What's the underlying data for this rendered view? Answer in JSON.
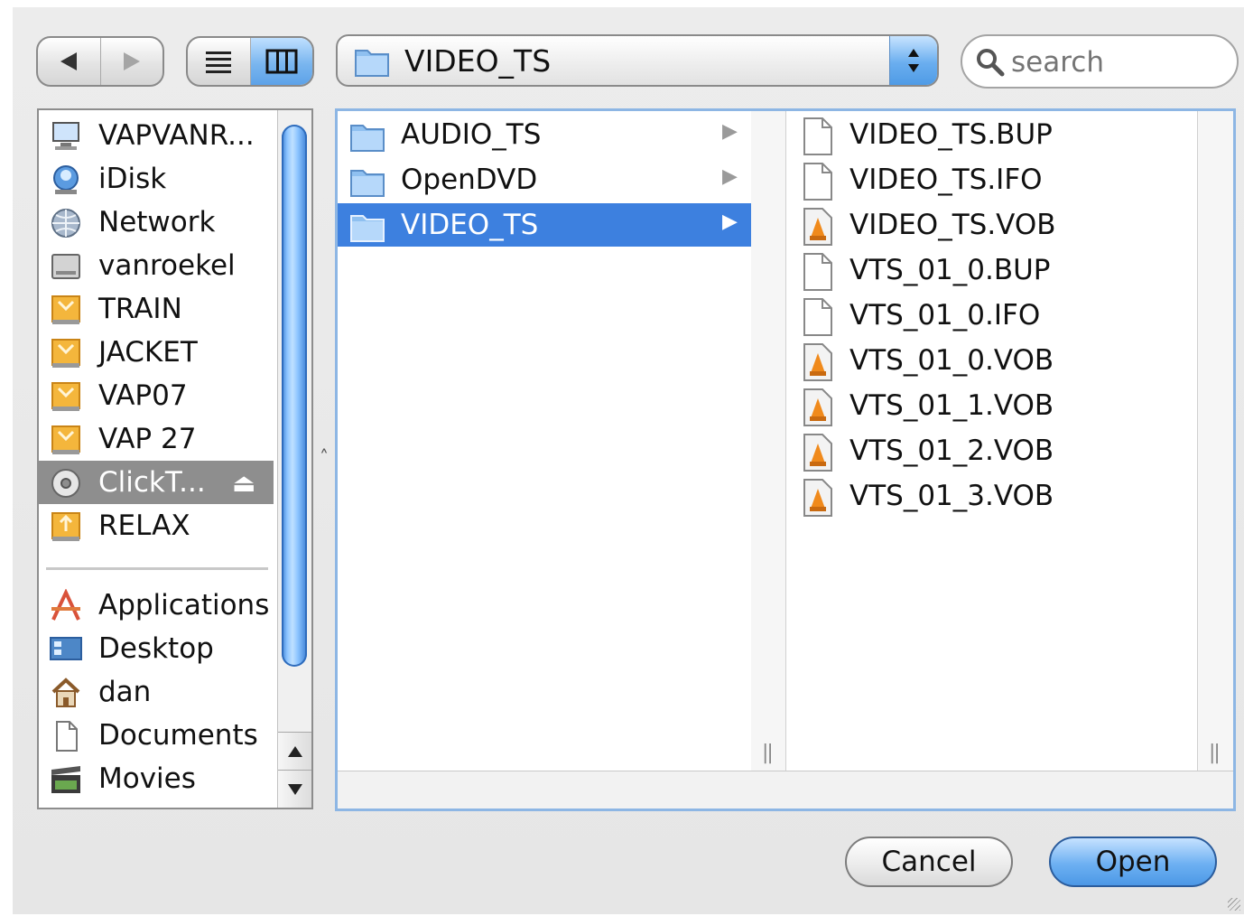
{
  "toolbar": {
    "back_icon": "back-arrow-icon",
    "forward_icon": "forward-arrow-icon",
    "list_view_icon": "list-view-icon",
    "column_view_icon": "column-view-icon",
    "path_popup_label": "VIDEO_TS",
    "search_placeholder": "search"
  },
  "sidebar": {
    "devices": [
      {
        "label": "VAPVANR...",
        "icon": "computer-icon"
      },
      {
        "label": "iDisk",
        "icon": "idisk-icon"
      },
      {
        "label": "Network",
        "icon": "network-icon"
      },
      {
        "label": "vanroekel",
        "icon": "hard-drive-icon"
      },
      {
        "label": "TRAIN",
        "icon": "drive-icon"
      },
      {
        "label": "JACKET",
        "icon": "drive-icon"
      },
      {
        "label": "VAP07",
        "icon": "drive-icon"
      },
      {
        "label": "VAP 27",
        "icon": "drive-icon"
      },
      {
        "label": "ClickT...",
        "icon": "dvd-disc-icon",
        "selected": true,
        "eject": "⏏"
      },
      {
        "label": "RELAX",
        "icon": "usb-drive-icon"
      }
    ],
    "places": [
      {
        "label": "Applications",
        "icon": "applications-icon"
      },
      {
        "label": "Desktop",
        "icon": "desktop-icon"
      },
      {
        "label": "dan",
        "icon": "home-icon"
      },
      {
        "label": "Documents",
        "icon": "documents-icon"
      },
      {
        "label": "Movies",
        "icon": "movies-icon"
      }
    ]
  },
  "browser": {
    "column1": [
      {
        "label": "AUDIO_TS",
        "icon": "folder-icon"
      },
      {
        "label": "OpenDVD",
        "icon": "folder-icon"
      },
      {
        "label": "VIDEO_TS",
        "icon": "folder-icon",
        "selected": true
      }
    ],
    "column2": [
      {
        "label": "VIDEO_TS.BUP",
        "icon": "document-icon"
      },
      {
        "label": "VIDEO_TS.IFO",
        "icon": "document-icon"
      },
      {
        "label": "VIDEO_TS.VOB",
        "icon": "vlc-file-icon"
      },
      {
        "label": "VTS_01_0.BUP",
        "icon": "document-icon"
      },
      {
        "label": "VTS_01_0.IFO",
        "icon": "document-icon"
      },
      {
        "label": "VTS_01_0.VOB",
        "icon": "vlc-file-icon"
      },
      {
        "label": "VTS_01_1.VOB",
        "icon": "vlc-file-icon"
      },
      {
        "label": "VTS_01_2.VOB",
        "icon": "vlc-file-icon"
      },
      {
        "label": "VTS_01_3.VOB",
        "icon": "vlc-file-icon"
      }
    ]
  },
  "buttons": {
    "cancel": "Cancel",
    "open": "Open"
  },
  "colors": {
    "selection": "#3d80df",
    "sidebar_selection": "#8e8e8e",
    "aqua_blue": "#5da2e8"
  }
}
